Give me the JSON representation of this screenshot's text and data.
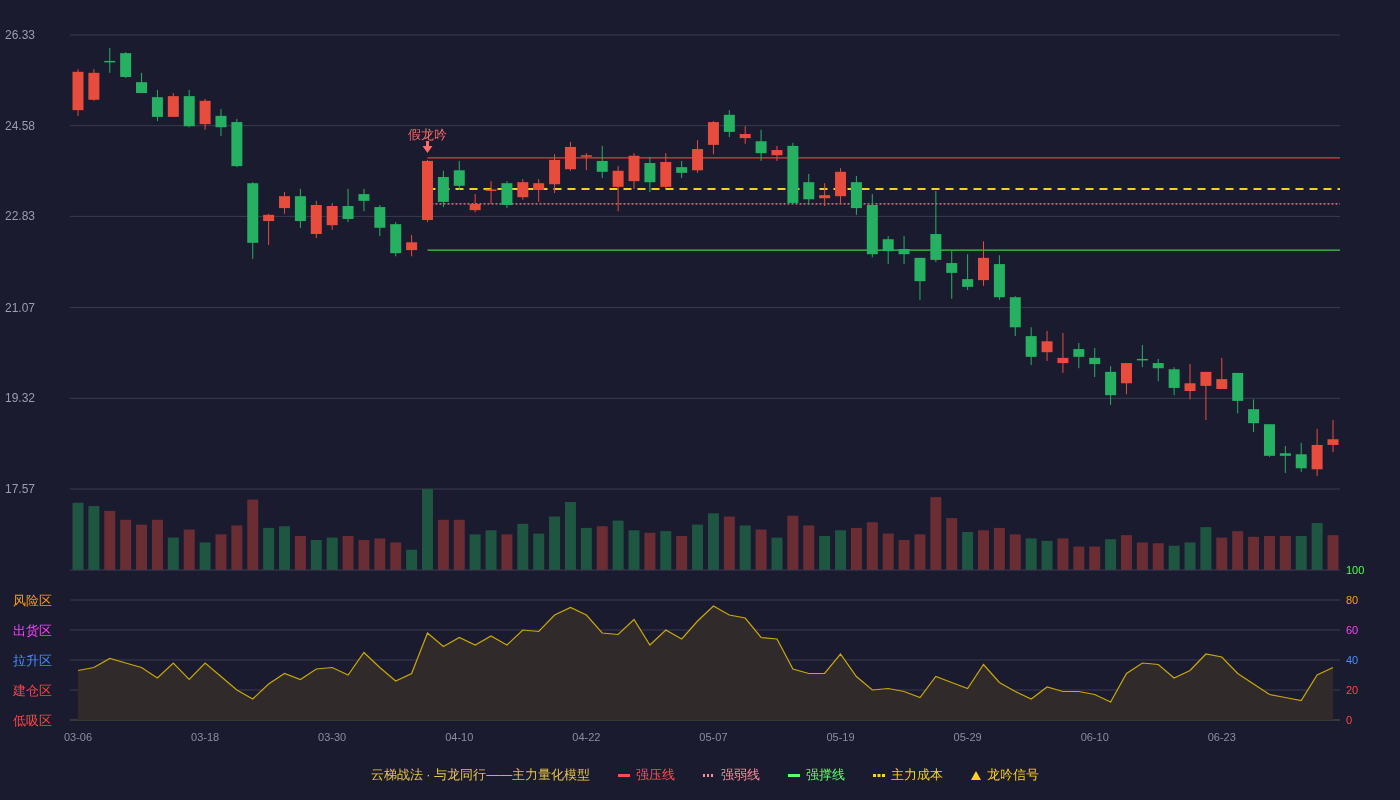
{
  "price_chart": {
    "chart_data": {
      "type": "candlestick",
      "grid": true,
      "ylim": [
        17.57,
        26.33
      ],
      "categories": [
        null,
        null,
        null,
        null,
        null,
        null,
        null,
        null,
        null,
        null,
        null,
        null,
        null,
        null,
        null,
        null,
        null,
        null,
        null,
        null,
        null,
        null,
        null,
        null,
        null,
        null,
        null,
        null,
        null,
        null,
        null,
        null,
        null,
        null,
        null,
        null,
        null,
        null,
        null,
        null,
        null,
        null,
        null,
        null,
        null,
        null,
        null,
        null,
        null,
        null,
        null,
        null,
        null,
        null,
        null,
        null,
        null,
        null,
        null,
        null,
        null,
        null,
        null,
        null,
        null,
        null,
        null,
        null,
        null,
        null,
        null,
        null,
        null,
        null,
        null,
        null,
        null,
        null,
        null,
        null
      ],
      "yticks": [
        {
          "value": 26.33,
          "label": "26.33"
        },
        {
          "value": 24.58,
          "label": "24.58"
        },
        {
          "value": 22.83,
          "label": "22.83"
        },
        {
          "value": 21.07,
          "label": "21.07"
        },
        {
          "value": 19.32,
          "label": "19.32"
        },
        {
          "value": 17.57,
          "label": "17.57"
        }
      ],
      "ohlc": [
        [
          24.88,
          25.67,
          24.77,
          25.62
        ],
        [
          25.08,
          25.67,
          25.06,
          25.6
        ],
        [
          25.83,
          26.08,
          25.6,
          25.81
        ],
        [
          25.98,
          26.0,
          25.5,
          25.52
        ],
        [
          25.42,
          25.6,
          25.21,
          25.21
        ],
        [
          25.13,
          25.27,
          24.67,
          24.75
        ],
        [
          24.75,
          25.21,
          24.75,
          25.15
        ],
        [
          25.15,
          25.27,
          24.55,
          24.57
        ],
        [
          24.61,
          25.1,
          24.5,
          25.06
        ],
        [
          24.77,
          24.9,
          24.38,
          24.55
        ],
        [
          24.65,
          24.71,
          23.78,
          23.8
        ],
        [
          23.47,
          23.49,
          22.01,
          22.32
        ],
        [
          22.74,
          22.88,
          22.28,
          22.86
        ],
        [
          22.99,
          23.3,
          22.88,
          23.22
        ],
        [
          23.22,
          23.36,
          22.61,
          22.74
        ],
        [
          22.49,
          23.13,
          22.41,
          23.05
        ],
        [
          22.66,
          23.09,
          22.57,
          23.03
        ],
        [
          23.03,
          23.36,
          22.72,
          22.78
        ],
        [
          23.26,
          23.36,
          22.93,
          23.13
        ],
        [
          23.01,
          23.05,
          22.45,
          22.61
        ],
        [
          22.68,
          22.72,
          22.06,
          22.12
        ],
        [
          22.18,
          22.47,
          22.06,
          22.33
        ],
        [
          22.76,
          23.92,
          22.72,
          23.9
        ],
        [
          23.59,
          23.71,
          23.01,
          23.11
        ],
        [
          23.72,
          23.9,
          23.34,
          23.42
        ],
        [
          22.95,
          23.26,
          22.91,
          23.07
        ],
        [
          23.33,
          23.51,
          23.07,
          23.35
        ],
        [
          23.47,
          23.51,
          22.99,
          23.05
        ],
        [
          23.2,
          23.55,
          23.15,
          23.49
        ],
        [
          23.34,
          23.55,
          23.11,
          23.47
        ],
        [
          23.45,
          24.03,
          23.28,
          23.92
        ],
        [
          23.74,
          24.27,
          23.71,
          24.17
        ],
        [
          23.98,
          24.05,
          23.72,
          24.01
        ],
        [
          23.9,
          24.19,
          23.57,
          23.69
        ],
        [
          23.4,
          23.8,
          22.93,
          23.71
        ],
        [
          23.51,
          24.05,
          23.36,
          24.0
        ],
        [
          23.86,
          23.98,
          23.3,
          23.49
        ],
        [
          23.4,
          24.05,
          23.38,
          23.88
        ],
        [
          23.78,
          23.9,
          23.57,
          23.67
        ],
        [
          23.72,
          24.3,
          23.67,
          24.13
        ],
        [
          24.21,
          24.67,
          24.03,
          24.65
        ],
        [
          24.79,
          24.88,
          24.36,
          24.46
        ],
        [
          24.34,
          24.57,
          24.23,
          24.42
        ],
        [
          24.28,
          24.5,
          23.9,
          24.05
        ],
        [
          24.01,
          24.19,
          23.9,
          24.11
        ],
        [
          24.19,
          24.25,
          23.07,
          23.09
        ],
        [
          23.49,
          23.65,
          23.05,
          23.16
        ],
        [
          23.18,
          23.47,
          23.03,
          23.24
        ],
        [
          23.22,
          23.76,
          23.07,
          23.69
        ],
        [
          23.49,
          23.61,
          22.86,
          22.99
        ],
        [
          23.05,
          23.26,
          22.04,
          22.1
        ],
        [
          22.39,
          22.45,
          21.91,
          22.16
        ],
        [
          22.2,
          22.45,
          21.91,
          22.1
        ],
        [
          22.03,
          22.03,
          21.22,
          21.58
        ],
        [
          22.49,
          23.32,
          21.95,
          21.99
        ],
        [
          21.93,
          22.18,
          21.24,
          21.74
        ],
        [
          21.62,
          22.1,
          21.41,
          21.47
        ],
        [
          21.6,
          22.35,
          21.49,
          22.03
        ],
        [
          21.91,
          22.08,
          21.22,
          21.27
        ],
        [
          21.27,
          21.29,
          20.52,
          20.69
        ],
        [
          20.52,
          20.69,
          19.96,
          20.12
        ],
        [
          20.21,
          20.62,
          20.04,
          20.42
        ],
        [
          20.0,
          20.58,
          19.81,
          20.1
        ],
        [
          20.27,
          20.39,
          19.9,
          20.12
        ],
        [
          20.1,
          20.29,
          19.73,
          19.98
        ],
        [
          19.83,
          19.94,
          19.19,
          19.38
        ],
        [
          19.61,
          20.0,
          19.4,
          20.0
        ],
        [
          20.08,
          20.35,
          19.92,
          20.07
        ],
        [
          20.0,
          20.08,
          19.65,
          19.9
        ],
        [
          19.88,
          19.92,
          19.38,
          19.52
        ],
        [
          19.46,
          19.98,
          19.3,
          19.61
        ],
        [
          19.56,
          19.83,
          18.9,
          19.83
        ],
        [
          19.5,
          20.1,
          19.5,
          19.69
        ],
        [
          19.81,
          19.81,
          19.03,
          19.27
        ],
        [
          19.11,
          19.3,
          18.67,
          18.84
        ],
        [
          18.82,
          18.82,
          18.19,
          18.21
        ],
        [
          18.26,
          18.4,
          17.88,
          18.21
        ],
        [
          18.24,
          18.46,
          17.9,
          17.97
        ],
        [
          17.95,
          18.73,
          17.82,
          18.42
        ],
        [
          18.42,
          18.9,
          18.28,
          18.53
        ]
      ],
      "ref_lines": [
        {
          "axis": "y",
          "value": 23.96,
          "color": "#e0403c"
        },
        {
          "axis": "y",
          "value": 23.36,
          "color": "#f2d21b"
        },
        {
          "axis": "y",
          "value": 23.07,
          "color": "#ff8a96"
        },
        {
          "axis": "y",
          "value": 22.18,
          "color": "#3fcf45"
        }
      ],
      "annotations": [
        "假龙吟"
      ]
    }
  },
  "indicator": {
    "zones": [
      "风险区",
      "出货区",
      "拉升区",
      "建仓区",
      "低吸区"
    ],
    "chart_data": {
      "type": "area",
      "grid": true,
      "ylim": [
        0,
        100
      ],
      "yticks": [
        {
          "value": 100,
          "label": "100"
        },
        {
          "value": 80,
          "label": "80"
        },
        {
          "value": 60,
          "label": "60"
        },
        {
          "value": 40,
          "label": "40"
        },
        {
          "value": 20,
          "label": "20"
        },
        {
          "value": 0,
          "label": "0"
        }
      ],
      "categories": [
        "03-06",
        null,
        null,
        null,
        null,
        null,
        null,
        null,
        "03-18",
        null,
        null,
        null,
        null,
        null,
        null,
        null,
        "03-30",
        null,
        null,
        null,
        null,
        null,
        null,
        null,
        "04-10",
        null,
        null,
        null,
        null,
        null,
        null,
        null,
        "04-22",
        null,
        null,
        null,
        null,
        null,
        null,
        null,
        "05-07",
        null,
        null,
        null,
        null,
        null,
        null,
        null,
        "05-19",
        null,
        null,
        null,
        null,
        null,
        null,
        null,
        "05-29",
        null,
        null,
        null,
        null,
        null,
        null,
        null,
        "06-10",
        null,
        null,
        null,
        null,
        null,
        null,
        null,
        "06-23",
        null,
        null,
        null,
        null,
        null,
        null,
        null
      ],
      "series": [
        {
          "color": "#c9a80a",
          "values": [
            33,
            35,
            41,
            38,
            35,
            28,
            38,
            27,
            38,
            29,
            20,
            14,
            24,
            31,
            27,
            34,
            35,
            30,
            45,
            35,
            26,
            31,
            58,
            49,
            55,
            50,
            56,
            50,
            60,
            59,
            70,
            75,
            70,
            58,
            57,
            67,
            50,
            60,
            54,
            66,
            76,
            70,
            68,
            55,
            54,
            34,
            31,
            31,
            44,
            29,
            20,
            21,
            19,
            15,
            29,
            25,
            21,
            37,
            25,
            19,
            14,
            22,
            19,
            19,
            17,
            12,
            31,
            38,
            37,
            28,
            33,
            44,
            42,
            31,
            24,
            17,
            15,
            13,
            30,
            35
          ]
        }
      ]
    }
  },
  "legend": {
    "title": "云梯战法 · 与龙同行——主力量化模型",
    "items": [
      {
        "kind": "solid",
        "label": "强压线",
        "color": "#ff4d4f"
      },
      {
        "kind": "dotted",
        "label": "强弱线",
        "color": "#ff8a9a"
      },
      {
        "kind": "solid",
        "label": "强撑线",
        "color": "#5cff6b"
      },
      {
        "kind": "dashed",
        "label": "主力成本",
        "color": "#ffd21f"
      },
      {
        "kind": "triangle",
        "label": "龙吟信号",
        "color": "#ffd21f"
      }
    ]
  }
}
